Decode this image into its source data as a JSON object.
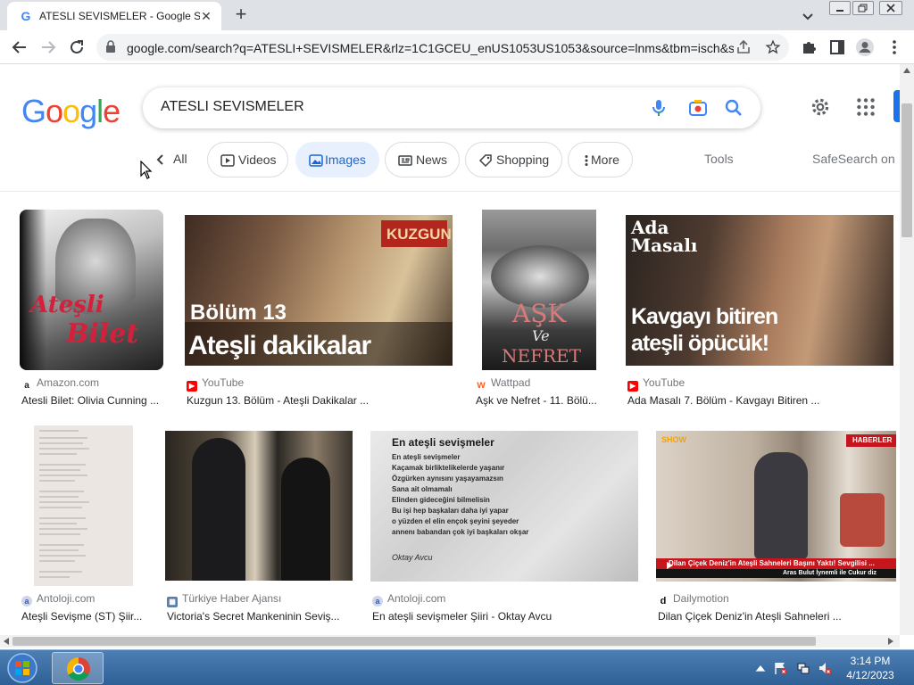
{
  "browser": {
    "tab_title": "ATESLI SEVISMELER - Google Sea",
    "tab_favicon": "G",
    "url": "google.com/search?q=ATESLI+SEVISMELER&rlz=1C1GCEU_enUS1053US1053&source=lnms&tbm=isch&sa..."
  },
  "google": {
    "logo": [
      "G",
      "o",
      "o",
      "g",
      "l",
      "e"
    ],
    "logo_colors": [
      "#4285f4",
      "#ea4335",
      "#fbbc05",
      "#4285f4",
      "#34a853",
      "#ea4335"
    ],
    "query": "ATESLI SEVISMELER"
  },
  "filters": {
    "all": "All",
    "chips": [
      "Videos",
      "Images",
      "News",
      "Shopping",
      "More"
    ],
    "active": "Images",
    "tools": "Tools",
    "safesearch": "SafeSearch on"
  },
  "results": [
    {
      "source": "Amazon.com",
      "title": "Atesli Bilet: Olivia Cunning ...",
      "overlay": [
        "Ateşli",
        "Bilet"
      ],
      "icon": "amazon-icon"
    },
    {
      "source": "YouTube",
      "title": "Kuzgun 13. Bölüm - Ateşli Dakikalar ...",
      "overlay": [
        "KUZGUN",
        "Bölüm 13",
        "Ateşli dakikalar"
      ],
      "icon": "youtube-icon"
    },
    {
      "source": "Wattpad",
      "title": "Aşk ve Nefret - 11. Bölü...",
      "overlay": [
        "AŞK",
        "Ve",
        "NEFRET"
      ],
      "icon": "wattpad-icon"
    },
    {
      "source": "YouTube",
      "title": "Ada Masalı 7. Bölüm - Kavgayı Bitiren ...",
      "overlay": [
        "Ada",
        "Masalı",
        "Kavgayı bitiren",
        "ateşli öpücük!"
      ],
      "icon": "youtube-icon"
    },
    {
      "source": "Antoloji.com",
      "title": "Ateşli Sevişme (ST) Şiir...",
      "icon": "antoloji-icon"
    },
    {
      "source": "Türkiye Haber Ajansı",
      "title": "Victoria's Secret Mankeninin Seviş...",
      "icon": "news-agency-icon"
    },
    {
      "source": "Antoloji.com",
      "title": "En ateşli sevişmeler Şiiri - Oktay Avcu",
      "icon": "antoloji-icon",
      "poem": {
        "heading": "En ateşli sevişmeler",
        "lines": [
          "En ateşli sevişmeler",
          "Kaçamak birliktelikelerde yaşanır",
          "Özgürken aynısını yaşayamazsın",
          "Sana ait olmamalı",
          "Elinden gideceğini bilmelisin",
          "Bu işi hep başkaları daha iyi yapar",
          "o yüzden el elin ençok şeyini şeyeder",
          "annenı babandan çok iyi başkaları okşar"
        ],
        "author": "Oktay Avcu"
      }
    },
    {
      "source": "Dailymotion",
      "title": "Dilan Çiçek Deniz'in Ateşli Sahneleri ...",
      "icon": "dailymotion-icon",
      "overlay": [
        "SHOW",
        "HABERLER",
        "Dilan Çiçek Deniz'in Ateşli Sahneleri Başını Yaktı! Sevgilisi ...",
        "Aras Bulut İynemli ile Cukur diz"
      ]
    }
  ],
  "taskbar": {
    "time": "3:14 PM",
    "date": "4/12/2023"
  }
}
